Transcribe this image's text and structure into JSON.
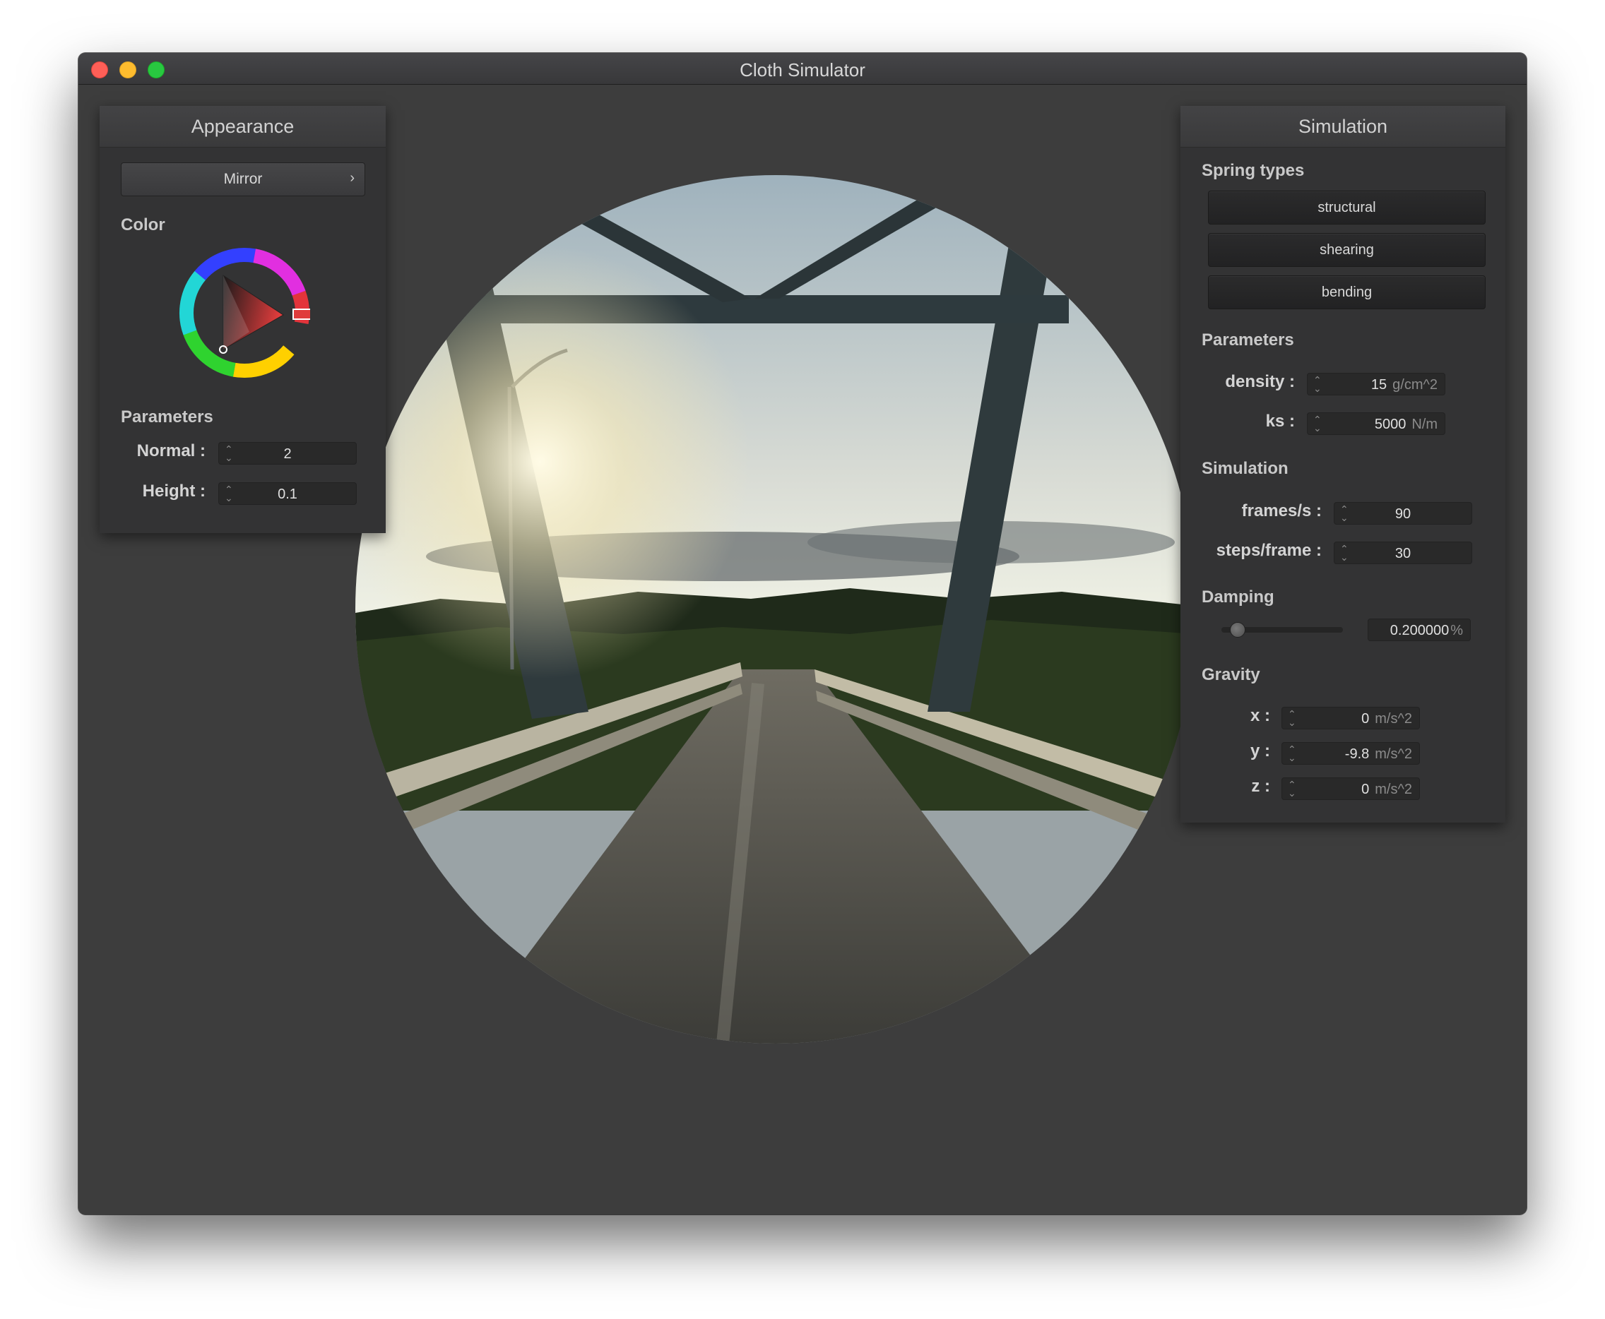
{
  "window": {
    "title": "Cloth Simulator"
  },
  "appearance": {
    "header": "Appearance",
    "shader_select": {
      "value": "Mirror"
    },
    "color_label": "Color",
    "parameters_label": "Parameters",
    "normal": {
      "label": "Normal :",
      "value": "2"
    },
    "height": {
      "label": "Height :",
      "value": "0.1"
    },
    "color_wheel_hex": "#e03c3c"
  },
  "simulation": {
    "header": "Simulation",
    "spring_types_label": "Spring types",
    "spring_types": [
      "structural",
      "shearing",
      "bending"
    ],
    "parameters_label": "Parameters",
    "density": {
      "label": "density :",
      "value": "15",
      "unit": "g/cm^2"
    },
    "ks": {
      "label": "ks :",
      "value": "5000",
      "unit": "N/m"
    },
    "simulation_label": "Simulation",
    "frames_per_s": {
      "label": "frames/s :",
      "value": "90"
    },
    "steps_per_frame": {
      "label": "steps/frame :",
      "value": "30"
    },
    "damping_label": "Damping",
    "damping": {
      "value": "0.200000",
      "unit": "%",
      "slider_fraction": 0.13
    },
    "gravity_label": "Gravity",
    "gravity": [
      {
        "label": "x :",
        "value": "0",
        "unit": "m/s^2"
      },
      {
        "label": "y :",
        "value": "-9.8",
        "unit": "m/s^2"
      },
      {
        "label": "z :",
        "value": "0",
        "unit": "m/s^2"
      }
    ]
  },
  "colors": {
    "window_bg": "#3d3d3d",
    "panel_bg": "#333334",
    "traffic_close": "#fe5f57",
    "traffic_min": "#febc2e",
    "traffic_max": "#28c840"
  }
}
